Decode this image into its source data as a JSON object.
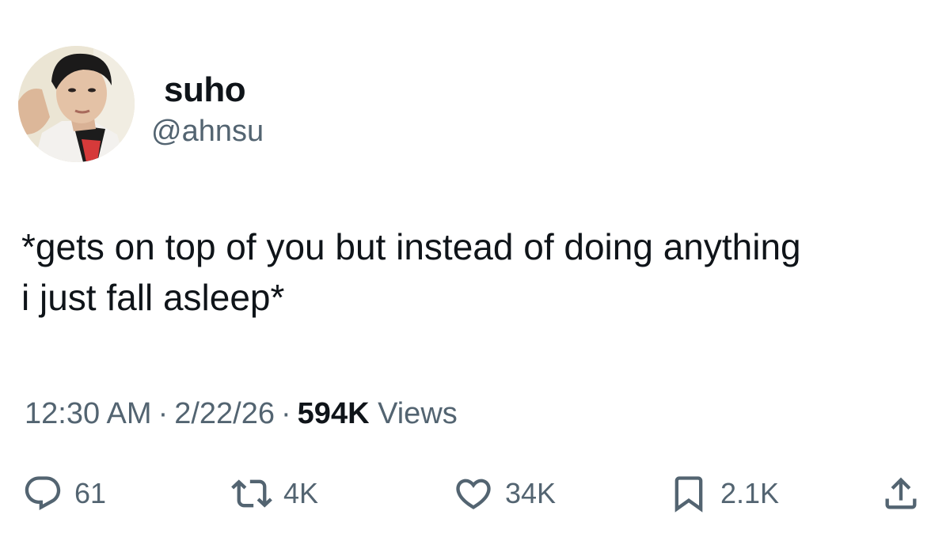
{
  "author": {
    "display_name": "suho",
    "handle": "@ahnsu"
  },
  "tweet": {
    "text": "*gets on top of you but instead of doing anything\ni just fall asleep*"
  },
  "meta": {
    "time": "12:30 AM",
    "separator": "·",
    "date": "2/22/26",
    "views_count": "594K",
    "views_label": "Views"
  },
  "actions": {
    "replies": "61",
    "retweets": "4K",
    "likes": "34K",
    "bookmarks": "2.1K"
  },
  "icons": {
    "reply": "reply-icon",
    "retweet": "retweet-icon",
    "like": "heart-icon",
    "bookmark": "bookmark-icon",
    "share": "share-icon"
  },
  "colors": {
    "text_primary": "#0f1419",
    "text_secondary": "#536471",
    "background": "#ffffff"
  }
}
